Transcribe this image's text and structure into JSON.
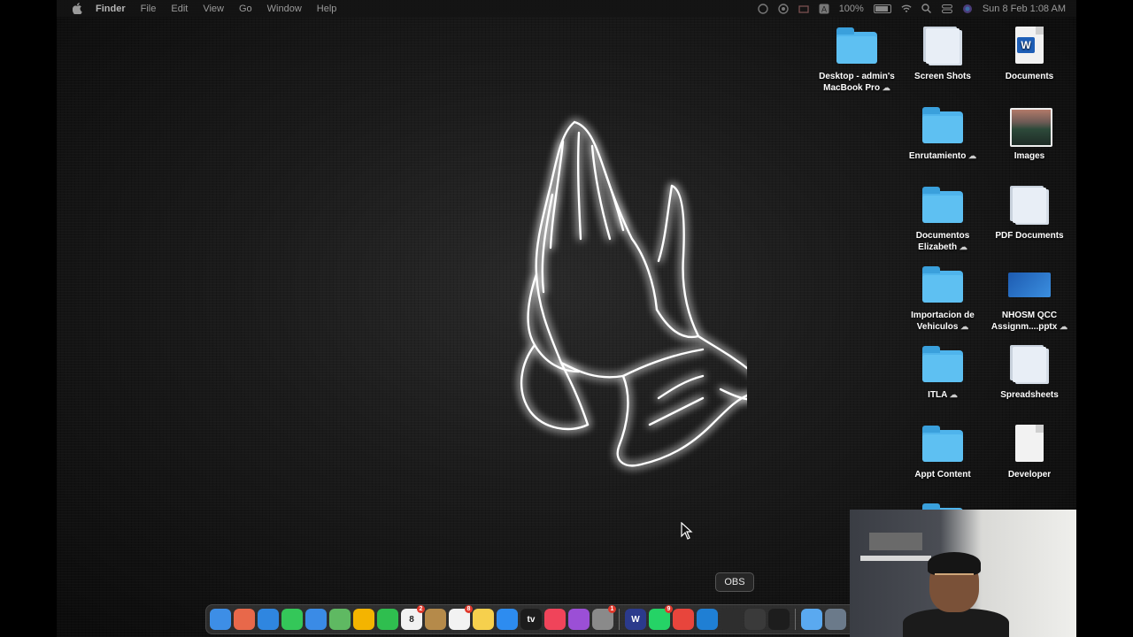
{
  "menubar": {
    "app_name": "Finder",
    "items": [
      "File",
      "Edit",
      "View",
      "Go",
      "Window",
      "Help"
    ],
    "battery_percent": "100%",
    "datetime": "Sun 8 Feb  1:08 AM"
  },
  "desktop_icons": [
    {
      "label": "Desktop - admin's MacBook Pro",
      "icon": "folder-icon",
      "cloud": true
    },
    {
      "label": "Screen Shots",
      "icon": "screenshot-stack-icon",
      "cloud": false
    },
    {
      "label": "Documents",
      "icon": "word-document-icon",
      "cloud": false
    },
    {
      "label": "Enrutamiento",
      "icon": "folder-icon",
      "cloud": true
    },
    {
      "label": "Images",
      "icon": "image-thumbnail-icon",
      "cloud": false
    },
    {
      "label": "Documentos Elizabeth",
      "icon": "folder-icon",
      "cloud": true
    },
    {
      "label": "PDF Documents",
      "icon": "pdf-stack-icon",
      "cloud": false
    },
    {
      "label": "Importacion de Vehiculos",
      "icon": "folder-icon",
      "cloud": true
    },
    {
      "label": "NHOSM QCC Assignm....pptx",
      "icon": "pptx-thumbnail-icon",
      "cloud": true
    },
    {
      "label": "ITLA",
      "icon": "folder-icon",
      "cloud": true
    },
    {
      "label": "Spreadsheets",
      "icon": "spreadsheet-stack-icon",
      "cloud": false
    },
    {
      "label": "Appt Content",
      "icon": "folder-icon",
      "cloud": false
    },
    {
      "label": "Developer",
      "icon": "blank-document-icon",
      "cloud": false
    }
  ],
  "tooltip": "OBS",
  "dock": {
    "apps": [
      {
        "name": "finder-icon",
        "color": "#3d8ee6"
      },
      {
        "name": "launchpad-icon",
        "color": "#e8684a"
      },
      {
        "name": "safari-icon",
        "color": "#2f86e0"
      },
      {
        "name": "messages-icon",
        "color": "#34c759"
      },
      {
        "name": "mail-icon",
        "color": "#3a8be6"
      },
      {
        "name": "maps-icon",
        "color": "#5fb962"
      },
      {
        "name": "photos-icon",
        "color": "#f4b400"
      },
      {
        "name": "facetime-icon",
        "color": "#2fbe4f"
      },
      {
        "name": "calendar-icon",
        "color": "#f2f2f2",
        "text": "8",
        "badge": "2"
      },
      {
        "name": "notes-brown-icon",
        "color": "#b58a4a"
      },
      {
        "name": "reminders-icon",
        "color": "#f2f2f2",
        "badge": "8"
      },
      {
        "name": "notes-icon",
        "color": "#f6d04d"
      },
      {
        "name": "app-store-icon",
        "color": "#2d8cf0"
      },
      {
        "name": "apple-tv-icon",
        "color": "#1c1c1c",
        "text": "tv"
      },
      {
        "name": "music-icon",
        "color": "#f0445a"
      },
      {
        "name": "podcasts-icon",
        "color": "#9b4fd6"
      },
      {
        "name": "system-settings-icon",
        "color": "#8a8a8a",
        "badge": "1"
      },
      {
        "name": "word-w-icon",
        "color": "#2b3a8c",
        "text": "W"
      },
      {
        "name": "whatsapp-icon",
        "color": "#25d366",
        "badge": "9"
      },
      {
        "name": "chrome-icon",
        "color": "#e8453c"
      },
      {
        "name": "vscode-icon",
        "color": "#1f7fd4"
      },
      {
        "name": "obs-icon",
        "color": "#2e2e2e"
      },
      {
        "name": "activity-monitor-icon",
        "color": "#3a3a3a"
      },
      {
        "name": "terminal-icon",
        "color": "#1d1d1d"
      },
      {
        "name": "preview-icon",
        "color": "#5aa9f0"
      },
      {
        "name": "folder-dock-icon",
        "color": "#6b7a8a"
      }
    ]
  }
}
